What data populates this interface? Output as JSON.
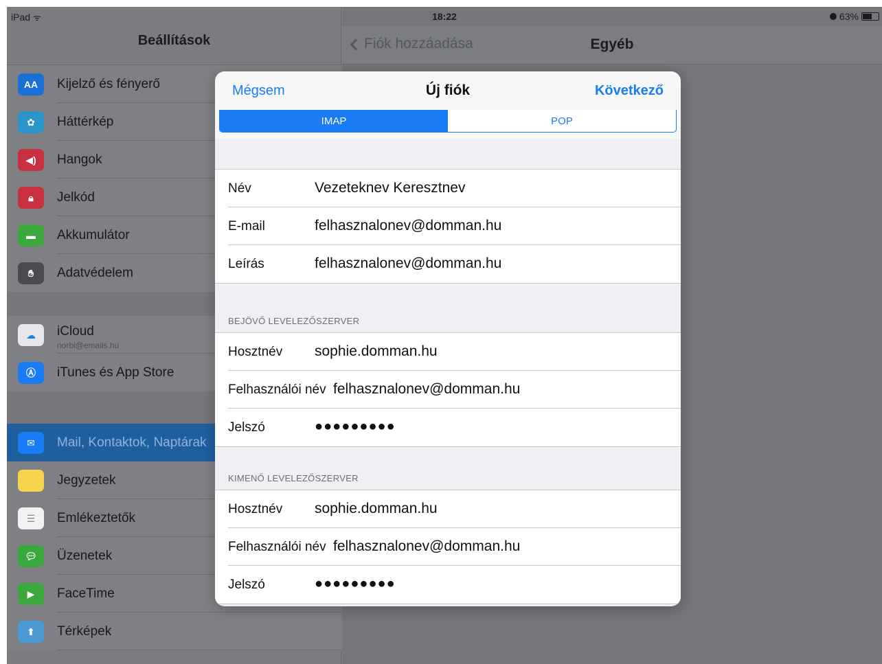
{
  "status_bar": {
    "device": "iPad",
    "time": "18:22",
    "battery_percent": "63%",
    "battery_level": 0.63
  },
  "master": {
    "title": "Beállítások",
    "items": [
      {
        "label": "Kijelző és fényerő",
        "icon": "display-brightness-icon",
        "color": "#1a6fd6"
      },
      {
        "label": "Háttérkép",
        "icon": "wallpaper-icon",
        "color": "#2b95c9"
      },
      {
        "label": "Hangok",
        "icon": "sounds-icon",
        "color": "#c9303f"
      },
      {
        "label": "Jelkód",
        "icon": "lock-icon",
        "color": "#c9303f"
      },
      {
        "label": "Akkumulátor",
        "icon": "battery-icon",
        "color": "#3aa83d"
      },
      {
        "label": "Adatvédelem",
        "icon": "hand-icon",
        "color": "#4a4b4f"
      },
      {
        "label": "iCloud",
        "sublabel": "norbi@emails.hu",
        "icon": "icloud-icon",
        "color": "#e6e6e8"
      },
      {
        "label": "iTunes és App Store",
        "icon": "app-store-icon",
        "color": "#1a7cf5"
      },
      {
        "label": "Mail, Kontaktok, Naptárak",
        "icon": "mail-icon",
        "color": "#1a7cf5",
        "selected": true
      },
      {
        "label": "Jegyzetek",
        "icon": "notes-icon",
        "color": "#f5d34a"
      },
      {
        "label": "Emlékeztetők",
        "icon": "reminders-icon",
        "color": "#f2f2f4"
      },
      {
        "label": "Üzenetek",
        "icon": "messages-icon",
        "color": "#3aa83d"
      },
      {
        "label": "FaceTime",
        "icon": "facetime-icon",
        "color": "#3aa83d"
      },
      {
        "label": "Térképek",
        "icon": "maps-icon",
        "color": "#4b9ad6"
      }
    ]
  },
  "detail": {
    "back_label": "Fiók hozzáadása",
    "title": "Egyéb"
  },
  "modal": {
    "cancel_label": "Mégsem",
    "title": "Új fiók",
    "next_label": "Következő",
    "segments": [
      "IMAP",
      "POP"
    ],
    "account": [
      {
        "label": "Név",
        "value": "Vezeteknev Keresztnev"
      },
      {
        "label": "E-mail",
        "value": "felhasznalonev@domman.hu"
      },
      {
        "label": "Leírás",
        "value": "felhasznalonev@domman.hu"
      }
    ],
    "incoming": {
      "header": "BEJÖVŐ LEVELEZŐSZERVER",
      "fields": [
        {
          "label": "Hosztnév",
          "value": "sophie.domman.hu"
        },
        {
          "label": "Felhasználói név",
          "value": "felhasznalonev@domman.hu"
        },
        {
          "label": "Jelszó",
          "value": "●●●●●●●●●"
        }
      ]
    },
    "outgoing": {
      "header": "KIMENŐ LEVELEZŐSZERVER",
      "fields": [
        {
          "label": "Hosztnév",
          "value": "sophie.domman.hu"
        },
        {
          "label": "Felhasználói név",
          "value": "felhasznalonev@domman.hu"
        },
        {
          "label": "Jelszó",
          "value": "●●●●●●●●●"
        }
      ]
    }
  }
}
